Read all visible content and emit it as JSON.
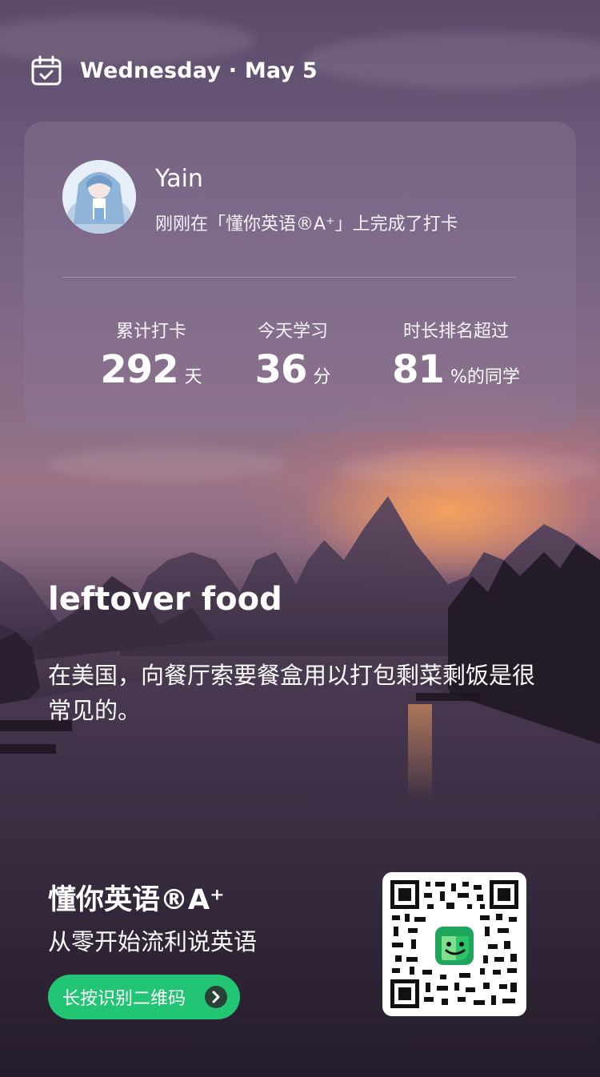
{
  "header": {
    "date": "Wednesday · May 5"
  },
  "card": {
    "user_name": "Yain",
    "status": "刚刚在「懂你英语®A⁺」上完成了打卡",
    "stats": [
      {
        "label": "累计打卡",
        "value": "292",
        "unit": "天"
      },
      {
        "label": "今天学习",
        "value": "36",
        "unit": "分"
      },
      {
        "label": "时长排名超过",
        "value": "81",
        "unit": "%的同学"
      }
    ]
  },
  "daily": {
    "word": "leftover food",
    "sentence": "在美国，向餐厅索要餐盒用以打包剩菜剩饭是很常见的。"
  },
  "footer": {
    "brand": "懂你英语®A⁺",
    "slogan": "从零开始流利说英语",
    "cta_label": "长按识别二维码"
  },
  "colors": {
    "accent_green": "#22c573",
    "card_bg": "rgba(140,120,150,0.42)"
  },
  "icons": {
    "header": "calendar-check-icon",
    "cta": "chevron-right-circle-icon",
    "qr_center": "app-logo-icon"
  }
}
